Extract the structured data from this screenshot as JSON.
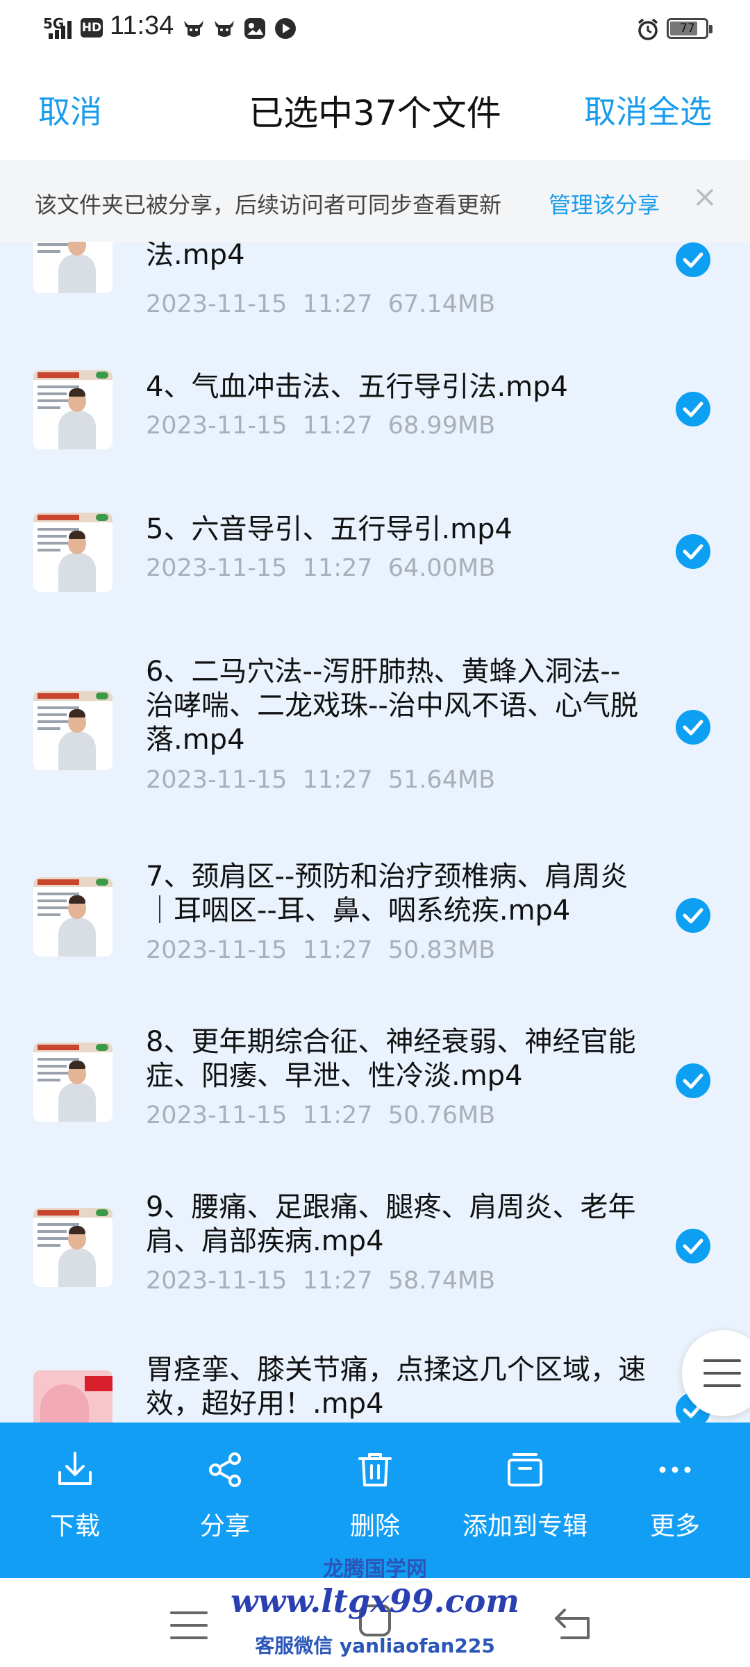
{
  "status_bar": {
    "network": "5G",
    "hd_badge": "HD",
    "time": "11:34",
    "battery": "77",
    "battery_level": 0.77
  },
  "header": {
    "cancel": "取消",
    "title": "已选中37个文件",
    "deselect_all": "取消全选"
  },
  "notice": {
    "text": "该文件夹已被分享，后续访问者可同步查看更新",
    "manage": "管理该分享"
  },
  "files": [
    {
      "name": "法.mp4",
      "meta": "2023-11-15  11:27  67.14MB",
      "selected": true
    },
    {
      "name": "4、气血冲击法、五行导引法.mp4",
      "meta": "2023-11-15  11:27  68.99MB",
      "selected": true
    },
    {
      "name": "5、六音导引、五行导引.mp4",
      "meta": "2023-11-15  11:27  64.00MB",
      "selected": true
    },
    {
      "name": "6、二马穴法--泻肝肺热、黄蜂入洞法--治哮喘、二龙戏珠--治中风不语、心气脱落.mp4",
      "meta": "2023-11-15  11:27  51.64MB",
      "selected": true
    },
    {
      "name": "7、颈肩区--预防和治疗颈椎病、肩周炎｜耳咽区--耳、鼻、咽系统疾.mp4",
      "meta": "2023-11-15  11:27  50.83MB",
      "selected": true
    },
    {
      "name": "8、更年期综合征、神经衰弱、神经官能症、阳痿、早泄、性冷淡.mp4",
      "meta": "2023-11-15  11:27  50.76MB",
      "selected": true
    },
    {
      "name": "9、腰痛、足跟痛、腿疼、肩周炎、老年肩、肩部疾病.mp4",
      "meta": "2023-11-15  11:27  58.74MB",
      "selected": true
    },
    {
      "name": "胃痉挛、膝关节痛，点揉这几个区域，速效，超好用！.mp4",
      "meta": "",
      "selected": true
    }
  ],
  "actions": {
    "download": "下载",
    "share": "分享",
    "delete": "删除",
    "add_to_album": "添加到专辑",
    "more": "更多"
  },
  "watermark": {
    "line1": "龙腾国学网",
    "line2": "www.ltgx99.com",
    "line3": "客服微信 yanliaofan225"
  },
  "colors": {
    "accent": "#1a9cec",
    "action_bar": "#129ef5",
    "list_bg": "#eaf3fd"
  }
}
